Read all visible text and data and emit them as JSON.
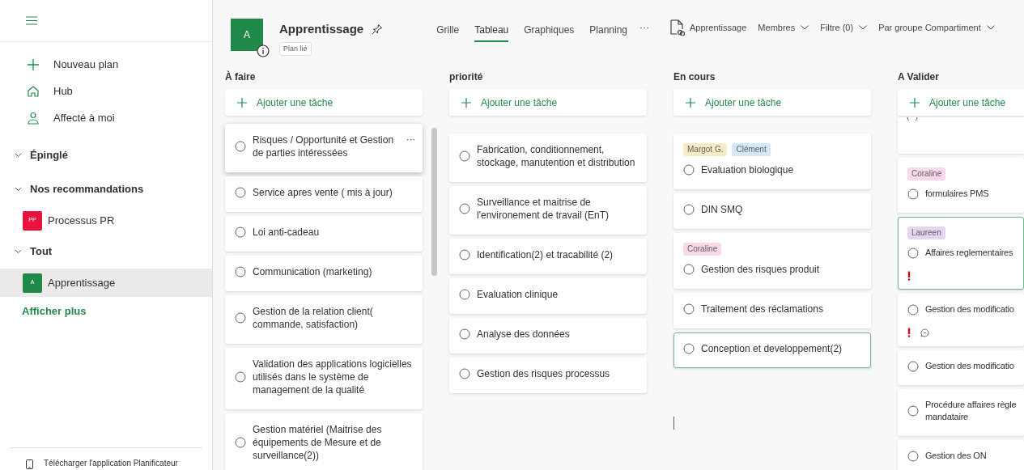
{
  "sidebar": {
    "nav": [
      {
        "label": "Nouveau plan"
      },
      {
        "label": "Hub"
      },
      {
        "label": "Affecté à moi"
      }
    ],
    "sections": [
      {
        "title": "Épinglé",
        "expanded": true
      },
      {
        "title": "Nos recommandations",
        "expanded": true,
        "plans": [
          {
            "initials": "PP",
            "name": "Processus PR",
            "color": "#e8123c",
            "selected": false
          }
        ]
      },
      {
        "title": "Tout",
        "expanded": true,
        "plans": [
          {
            "initials": "A",
            "name": "Apprentissage",
            "color": "#21894a",
            "selected": true
          }
        ]
      }
    ],
    "show_more": "Afficher plus",
    "footer": "Télécharger l'application Planificateur"
  },
  "header": {
    "avatar": "A",
    "title": "Apprentissage",
    "badge": "Plan lié",
    "tabs": [
      {
        "label": "Grille",
        "selected": false
      },
      {
        "label": "Tableau",
        "selected": true
      },
      {
        "label": "Graphiques",
        "selected": false
      },
      {
        "label": "Planning",
        "selected": false
      }
    ],
    "more": "···",
    "linked": "Apprentissage",
    "members": "Membres",
    "filter": "Filtre (0)",
    "group_by": "Par groupe Compartiment"
  },
  "buckets": [
    {
      "name": "À faire",
      "add_task": "Ajouter une tâche",
      "scrollbar": true,
      "tasks": [
        {
          "title": "Risques / Opportunité et Gestion de parties intéressées",
          "highlighted": false,
          "hovered": true,
          "more": "···"
        },
        {
          "title": "Service apres vente ( mis à jour)",
          "highlighted": false,
          "hovered": false
        },
        {
          "title": "Loi anti-cadeau",
          "highlighted": false,
          "hovered": false
        },
        {
          "title": "Communication (marketing)",
          "highlighted": false,
          "hovered": false
        },
        {
          "title": "Gestion de la relation client( commande, satisfaction)",
          "highlighted": false,
          "hovered": false
        },
        {
          "title": "Validation des applications logicielles utilisés dans le système de management de la qualité",
          "highlighted": false,
          "hovered": false
        },
        {
          "title": "Gestion matériel (Maitrise des équipements de Mesure et de surveillance(2))",
          "highlighted": false,
          "hovered": false
        }
      ]
    },
    {
      "name": "priorité",
      "add_task": "Ajouter une tâche",
      "scrollbar": false,
      "tasks": [
        {
          "title": "Fabrication, conditionnement, stockage, manutention et distribution",
          "highlighted": false
        },
        {
          "title": "Surveillance et maitrise de l'environement de travail (EnT)",
          "highlighted": false
        },
        {
          "title": "Identification(2) et tracabilité (2)",
          "highlighted": false
        },
        {
          "title": "Evaluation clinique",
          "highlighted": false
        },
        {
          "title": "Analyse des données",
          "highlighted": false
        },
        {
          "title": "Gestion des risques processus",
          "highlighted": false
        }
      ]
    },
    {
      "name": "En cours",
      "add_task": "Ajouter une tâche",
      "scrollbar": false,
      "cursor": true,
      "tasks": [
        {
          "title": "Evaluation biologique",
          "labels": [
            {
              "text": "Margot G.",
              "color": "#f5ecc6"
            },
            {
              "text": "Clément",
              "color": "#d4e8f8"
            }
          ],
          "highlighted": false
        },
        {
          "title": "DIN SMQ",
          "highlighted": false
        },
        {
          "title": "Gestion des risques produit",
          "labels": [
            {
              "text": "Coraline",
              "color": "#f9d8ec"
            }
          ],
          "highlighted": false
        },
        {
          "title": "Traitement des réclamations",
          "highlighted": false
        },
        {
          "title": "Conception et developpement(2)",
          "highlighted": true
        }
      ]
    },
    {
      "name": "A Valider",
      "add_task": "Ajouter une tâche",
      "scrollbar": false,
      "clipped": true,
      "tasks": [
        {
          "title": "formulaires PMS",
          "labels": [
            {
              "text": "Coraline",
              "color": "#f9d8ec"
            }
          ],
          "highlighted": false,
          "urgent": false,
          "comment": false
        },
        {
          "title": "Affaires reglementaires",
          "labels": [
            {
              "text": "Laureen",
              "color": "#e3d6ef"
            }
          ],
          "highlighted": true,
          "urgent": true,
          "comment": false
        },
        {
          "title": "Gestion des modificatio",
          "highlighted": false,
          "urgent": true,
          "comment": true
        },
        {
          "title": "Gestion des modificatio",
          "highlighted": false,
          "urgent": false,
          "comment": false
        },
        {
          "title": "Procédure affaires règle mandataire",
          "highlighted": false,
          "urgent": false,
          "comment": false
        },
        {
          "title": "Gestion des ON",
          "highlighted": false,
          "urgent": false,
          "comment": false
        }
      ]
    }
  ]
}
